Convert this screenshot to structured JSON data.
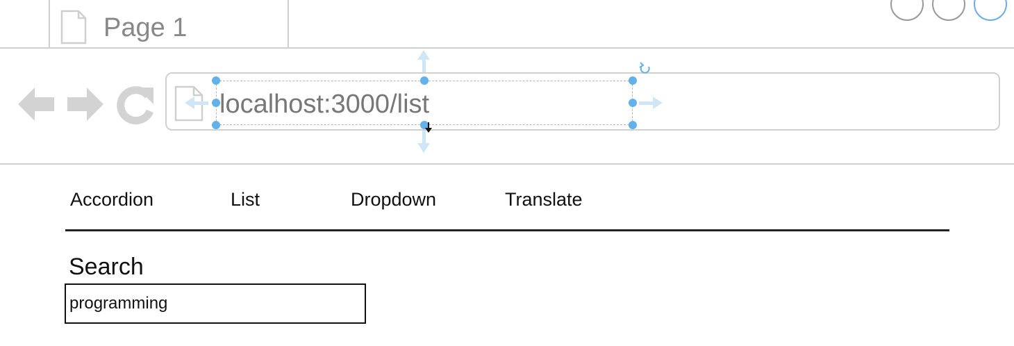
{
  "browser": {
    "tab": {
      "title": "Page 1",
      "icon": "page-icon"
    },
    "window_controls": [
      "circle-button",
      "circle-button",
      "circle-button"
    ],
    "toolbar": {
      "back_icon": "arrow-left-icon",
      "forward_icon": "arrow-right-icon",
      "reload_icon": "reload-icon"
    },
    "address_bar": {
      "icon": "page-icon",
      "url": "localhost:3000/list"
    }
  },
  "page": {
    "nav": {
      "items": [
        {
          "label": "Accordion"
        },
        {
          "label": "List"
        },
        {
          "label": "Dropdown"
        },
        {
          "label": "Translate"
        }
      ]
    },
    "search": {
      "label": "Search",
      "value": "programming"
    }
  },
  "colors": {
    "chrome_gray": "#cfcfcf",
    "icon_gray": "#d0d0d0",
    "selection_blue": "#63b1ea",
    "text_dark": "#111111"
  }
}
